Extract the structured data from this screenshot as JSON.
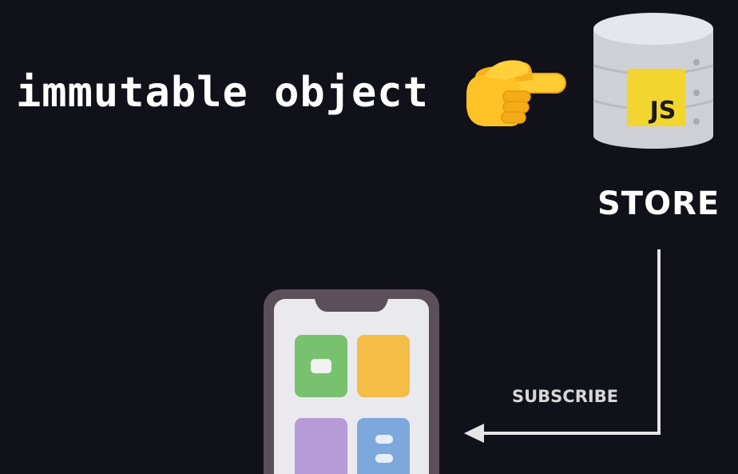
{
  "caption": "immutable object",
  "store": {
    "label": "STORE",
    "badge_text": "JS",
    "badge_color": "#f3d52f"
  },
  "subscribe": {
    "label": "SUBSCRIBE"
  },
  "icons": {
    "pointer": "pointing-hand-icon",
    "database": "database-icon",
    "app": "smartphone-app-icon"
  },
  "colors": {
    "background": "#11111a",
    "text": "#ffffff",
    "arrow": "#e6e6e6",
    "tile_green": "#78c16f",
    "tile_yellow": "#f3bd46",
    "tile_purple": "#b79ad8",
    "tile_blue": "#7ca8dc"
  }
}
